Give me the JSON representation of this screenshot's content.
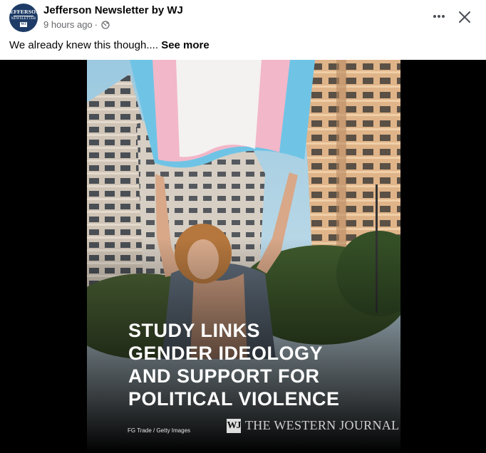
{
  "post": {
    "page_name": "Jefferson Newsletter by WJ",
    "time": "9 hours ago",
    "separator": "·",
    "privacy_icon": "globe-icon",
    "caption": "We already knew this though....",
    "see_more": "See more",
    "avatar": {
      "line1": "JEFFERSON",
      "line2": "NEWSLETTER",
      "mono": "WJ"
    }
  },
  "actions": {
    "more_icon": "more-horizontal-icon",
    "close_icon": "close-icon"
  },
  "image": {
    "headline_lines": [
      "STUDY LINKS",
      "GENDER IDEOLOGY",
      "AND SUPPORT FOR",
      "POLITICAL VIOLENCE"
    ],
    "credit": "FG Trade / Getty Images",
    "brand_mark": "WJ",
    "brand_name": "THE WESTERN JOURNAL"
  },
  "colors": {
    "avatar_bg": "#1d3b66",
    "text_primary": "#050505",
    "text_secondary": "#65676b",
    "media_bg": "#000000",
    "flag_blue": "#6fc4e6",
    "flag_pink": "#f2b7c8",
    "flag_white": "#f4f1f1"
  }
}
